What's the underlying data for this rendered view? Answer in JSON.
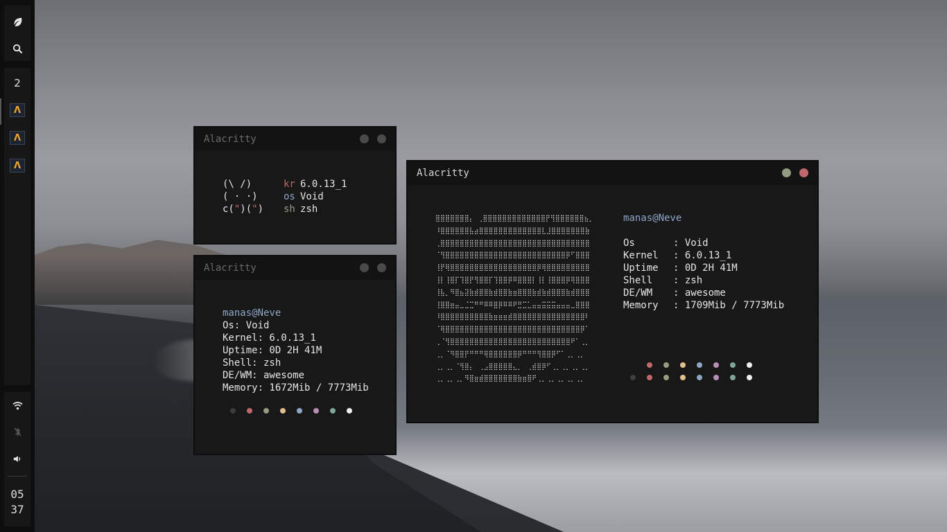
{
  "colors": {
    "gray": "#3d3d3d",
    "red": "#c0686b",
    "green": "#939d80",
    "yellow": "#e2c08d",
    "blue": "#8fa6c6",
    "magenta": "#b88fb5",
    "cyan": "#7fa59a",
    "white": "#eeeeee",
    "user": "#8fa6c6"
  },
  "sidebar": {
    "leaf_icon": "leaf-icon",
    "search_icon": "search-icon",
    "workspace": "2",
    "app_icon_glyph": "Λ",
    "wifi_icon": "wifi-icon",
    "bluetooth_icon": "bluetooth-off-icon",
    "volume_icon": "volume-icon",
    "clock_hour": "05",
    "clock_min": "37"
  },
  "win1": {
    "title": "Alacritty",
    "art": [
      "(\\ /)",
      "( · ·)",
      "c(\")(\")"
    ],
    "keys": [
      "kr",
      "os",
      "sh"
    ],
    "vals": [
      "6.0.13_1",
      "Void",
      "zsh"
    ]
  },
  "win2": {
    "title": "Alacritty",
    "user": "manas@Neve",
    "lines": [
      "Os: Void",
      "Kernel: 6.0.13_1",
      "Uptime: 0D 2H 41M",
      "Shell: zsh",
      "DE/WM: awesome",
      "Memory: 1672Mib / 7773Mib"
    ]
  },
  "win3": {
    "title": "Alacritty",
    "user": "manas@Neve",
    "labels": [
      "Os",
      "Kernel",
      "Uptime",
      "Shell",
      "DE/WM",
      "Memory"
    ],
    "values": [
      ": Void",
      ": 6.0.13_1",
      ": 0D 2H 41M",
      ": zsh",
      ": awesome",
      ": 1709Mib / 7773Mib"
    ],
    "ascii": [
      "⣿⣿⣿⣿⣿⣿⣿⡄ ⢀⣿⣿⣿⣿⣿⣿⣿⣿⣿⣿⣿⣿⣿⡟⢻⣿⣿⣿⣿⣿⣿⣦⡀",
      "⠸⣿⣿⣿⣿⣿⣿⣧⣴⣿⣿⣿⣿⣿⣿⣿⣿⣿⣿⣿⣿⣿⣇⣸⣿⣿⣿⣿⣿⣿⣿⣷",
      "⢀⣿⣿⣿⣿⣿⣿⣿⣿⣿⣿⣿⣿⣿⣿⣿⣿⣿⣿⣿⣿⣿⣿⣿⣿⣿⣿⣿⣿⣿⣿⣿",
      "⠈⢻⣿⣿⣿⣿⣿⣿⣿⣿⣿⣿⣿⣿⣿⣿⣿⣿⣿⣿⣿⣿⣿⣿⣿⣿⣿⡿⠋⣿⣿⣿",
      "⢸⡟⢿⣿⣿⣿⣿⣿⣿⣿⣿⣿⣿⣿⣿⣿⣿⣿⣿⣿⣿⡿⢿⣿⣿⣿⣿⣿⣿⣿⣿⣿",
      "⢸⡇⢸⣿⡏⢹⣿⡟⢻⣿⣿⡏⢹⣿⣿⡿⠿⣿⣿⣿⡇⢸⡇⢸⣿⣿⣿⡿⢿⣿⣿⣿",
      "⢸⣧⡀⠻⣿⣦⣽⣷⣾⣿⣿⣷⣾⣿⣿⣷⣶⣿⣿⣿⣷⣾⣷⣾⣿⣿⣿⣷⣾⣿⣿⣿",
      "⢸⣿⣿⣶⣤⣀⣈⣉⠛⠛⠿⠿⣿⡿⠿⠿⠟⣛⣉⣁⣤⣤⣭⣭⣭⣤⣤⣤⣀⣿⣿⣿",
      "⠸⣿⣿⣿⣿⣿⣿⣿⣿⣿⣿⣷⣶⣶⣶⣾⣿⣿⣿⣿⣿⣿⣿⣿⣿⣿⣿⣿⣿⣿⣿⠇",
      "⠈⢿⣿⣿⣿⣿⣿⣿⣿⣿⣿⣿⣿⣿⣿⣿⣿⣿⣿⣿⣿⣿⣿⣿⣿⣿⣿⣿⣿⣿⡿⠁",
      "⢀⠈⢻⣿⣿⣿⣿⣿⣿⣿⣿⣿⣿⣿⣿⣿⣿⣿⣿⣿⣿⣿⣿⣿⣿⣿⣿⣿⠟⠁⢀⡀",
      "⢀⡀⠈⠻⣿⣿⡟⠛⠛⠛⢿⣿⣿⣿⣿⣿⣿⡿⠛⠛⠛⢻⣿⣿⡿⠋⠁⢀⡀⢀⡀",
      "⢀⡀⢀⡀⠈⢻⣿⡄⠀⢀⣠⣿⣿⣿⣿⣿⣄⡀⠀⢀⣾⣿⡿⠋⢀⡀⢀⡀⢀⡀⢀⡀",
      "⢀⡀⢀⡀⢀⡀⠻⣿⣶⣾⣿⣿⣿⣿⣿⣿⣿⣷⣶⣿⠟⢀⡀⢀⡀⢀⡀⢀⡀⢀⡀"
    ]
  }
}
